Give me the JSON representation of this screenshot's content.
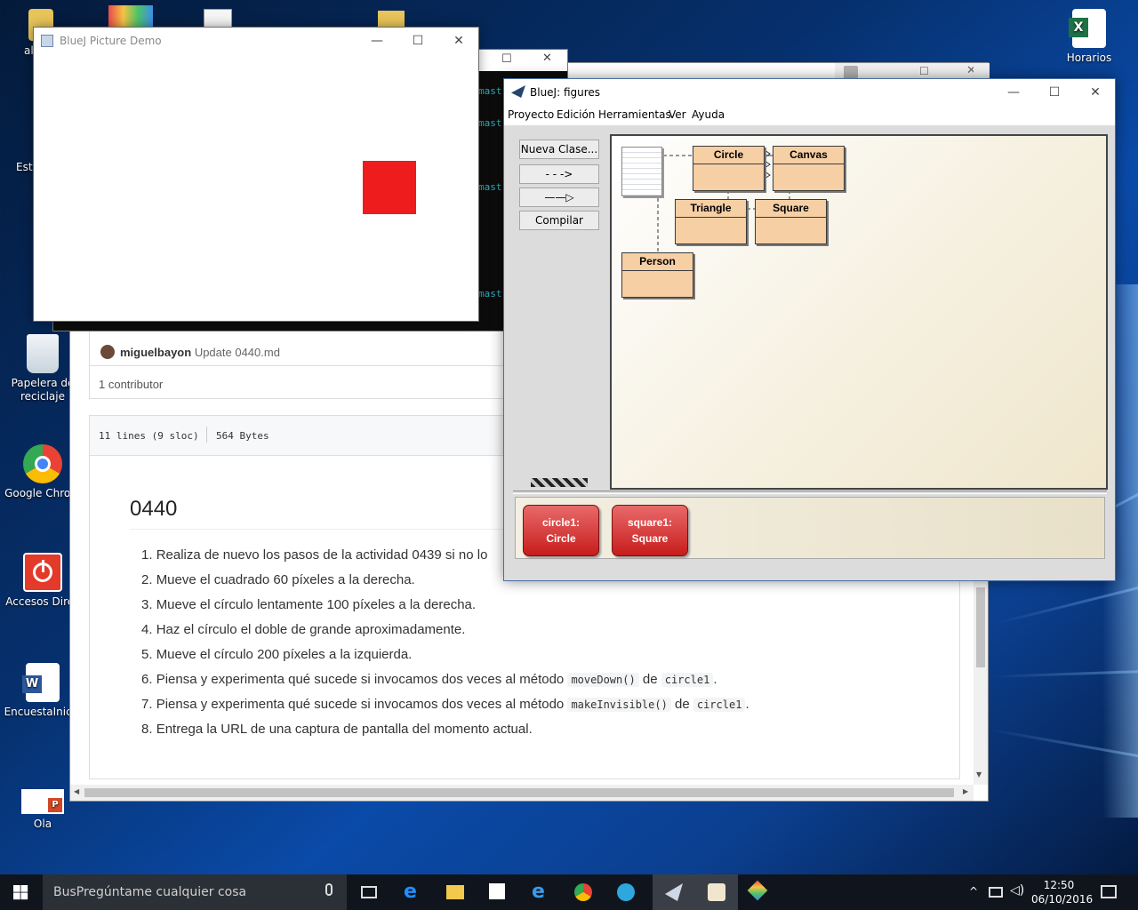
{
  "desktop": {
    "icons": [
      {
        "label": "al"
      },
      {
        "label": "Este"
      },
      {
        "label": "Papelera de reciclaje"
      },
      {
        "label": "Google Chrom"
      },
      {
        "label": "Accesos Direc"
      },
      {
        "label": "EncuestaInicia"
      },
      {
        "label": "Ola"
      },
      {
        "label": "Horarios"
      }
    ]
  },
  "github": {
    "author": "miguelbayon",
    "commit_msg": "Update 0440.md",
    "contributors": "1 contributor",
    "lines": "11 lines (9 sloc)",
    "size": "564 Bytes",
    "heading": "0440",
    "items": [
      {
        "num": "1.",
        "text": "Realiza de nuevo los pasos de la actividad 0439 si no lo"
      },
      {
        "num": "2.",
        "text": "Mueve el cuadrado 60 píxeles a la derecha."
      },
      {
        "num": "3.",
        "text": "Mueve el círculo lentamente 100 píxeles a la derecha."
      },
      {
        "num": "4.",
        "text": "Haz el círculo el doble de grande aproximadamente."
      },
      {
        "num": "5.",
        "text": "Mueve el círculo 200 píxeles a la izquierda."
      },
      {
        "num": "6.",
        "text": "Piensa y experimenta qué sucede si invocamos dos veces al método",
        "code1": "moveDown()",
        "mid": "de",
        "code2": "circle1",
        "end": "."
      },
      {
        "num": "7.",
        "text": "Piensa y experimenta qué sucede si invocamos dos veces al método",
        "code1": "makeInvisible()",
        "mid": "de",
        "code2": "circle1",
        "end": "."
      },
      {
        "num": "8.",
        "text": "Entrega la URL de una captura de pantalla del momento actual."
      }
    ]
  },
  "terminal": {
    "lines": [
      "mast",
      "mast",
      "mast",
      "mast"
    ]
  },
  "picture_demo": {
    "title": "BlueJ Picture Demo",
    "square_color": "#ee1c1c"
  },
  "bluej": {
    "title": "BlueJ:  figures",
    "menu": [
      "Proyecto",
      "Edición",
      "Herramientas",
      "Ver",
      "Ayuda"
    ],
    "buttons": {
      "new_class": "Nueva Clase...",
      "dep_arrow": "- - ->",
      "inh_arrow": "——▷",
      "compile": "Compilar"
    },
    "classes": [
      "Circle",
      "Canvas",
      "Triangle",
      "Square",
      "Person"
    ],
    "objects": [
      {
        "line1": "circle1:",
        "line2": "Circle"
      },
      {
        "line1": "square1:",
        "line2": "Square"
      }
    ]
  },
  "taskbar": {
    "search_placeholder": "BusPregúntame cualquier cosa",
    "time": "12:50",
    "date": "06/10/2016"
  }
}
